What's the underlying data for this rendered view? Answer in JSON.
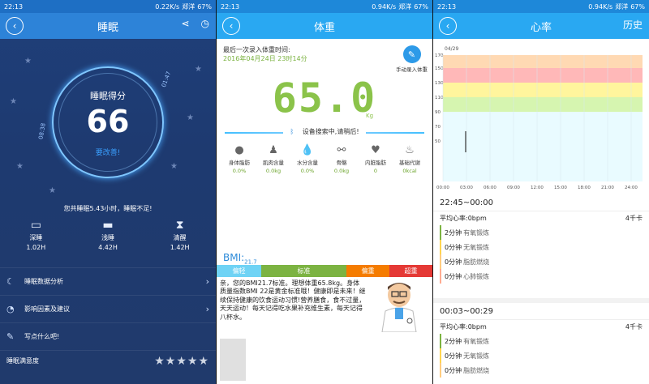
{
  "status": {
    "time": "22:13",
    "s1_speed": "0.22K/s",
    "s23_speed": "0.94K/s",
    "carrier": "郑洋",
    "battery": "67%"
  },
  "sleep": {
    "title": "睡眠",
    "score_label": "睡眠得分",
    "score": "66",
    "score_hint": "要改善!",
    "start_time": "08:38",
    "end_time": "01:47",
    "summary": "您共睡眠5.43小时，睡眠不足!",
    "stages": [
      {
        "label": "深睡",
        "value": "1.02H",
        "icon": "bed-deep-icon"
      },
      {
        "label": "浅睡",
        "value": "4.42H",
        "icon": "bed-light-icon"
      },
      {
        "label": "清醒",
        "value": "1.42H",
        "icon": "clock-icon"
      }
    ],
    "menu": [
      {
        "label": "睡眠数据分析",
        "icon": "moon-icon"
      },
      {
        "label": "影响因素及建议",
        "icon": "gauge-icon"
      },
      {
        "label": "写点什么吧!",
        "icon": "edit-icon"
      }
    ],
    "satisfaction_label": "睡眠满意度",
    "rating_stars": 5,
    "accent": "#3aa0ff"
  },
  "weight": {
    "title": "体重",
    "last_label": "最后一次录入体重时间:",
    "last_date": "2016年04月24日 23时14分",
    "manual_label": "手动录入体重",
    "value": "65.0",
    "unit": "Kg",
    "searching": "设备搜索中,请稍后!",
    "metrics": [
      {
        "label": "身体脂肪",
        "value": "0.0%"
      },
      {
        "label": "肌肉含量",
        "value": "0.0kg"
      },
      {
        "label": "水分含量",
        "value": "0.0%"
      },
      {
        "label": "骨骼",
        "value": "0.0kg"
      },
      {
        "label": "内脏脂肪",
        "value": "0"
      },
      {
        "label": "基础代谢",
        "value": "0kcal"
      }
    ],
    "bmi_label": "BMI:",
    "bmi_value": "21.7",
    "bmi_levels": [
      {
        "label": "偏轻",
        "color": "#6fd3f5"
      },
      {
        "label": "标准",
        "color": "#7cb342"
      },
      {
        "label": "偏重",
        "color": "#f57c00"
      },
      {
        "label": "超重",
        "color": "#e53935"
      }
    ],
    "advice": "亲，您的BMI21.7标准。理想体重65.8kg。身体质量指数BMI 22是黄金标准哦！健康即是未来！继续保持健康的饮食运动习惯!营养膳食，食不过量，天天运动！每天记得吃水果补充维生素，每天记得八杯水。"
  },
  "heart": {
    "title": "心率",
    "history_label": "历史",
    "chart_date": "04/29",
    "y_ticks": [
      "170",
      "150",
      "130",
      "110",
      "90",
      "70",
      "50"
    ],
    "x_ticks": [
      "00:00",
      "03:00",
      "06:00",
      "09:00",
      "12:00",
      "15:00",
      "18:00",
      "21:00",
      "24:00"
    ],
    "sessions": [
      {
        "time": "22:45~00:00",
        "avg": "平均心率:0bpm",
        "kcal": "4千卡",
        "rows": [
          {
            "dur": "2分钟",
            "label": "有氧锻炼",
            "color": "#7cb342"
          },
          {
            "dur": "0分钟",
            "label": "无氧锻炼",
            "color": "#ffd54f"
          },
          {
            "dur": "0分钟",
            "label": "脂肪燃烧",
            "color": "#ffcc80"
          },
          {
            "dur": "0分钟",
            "label": "心肺锻炼",
            "color": "#ffab91"
          }
        ]
      },
      {
        "time": "00:03~00:29",
        "avg": "平均心率:0bpm",
        "kcal": "4千卡",
        "rows": [
          {
            "dur": "2分钟",
            "label": "有氧锻炼",
            "color": "#7cb342"
          },
          {
            "dur": "0分钟",
            "label": "无氧锻炼",
            "color": "#ffd54f"
          },
          {
            "dur": "0分钟",
            "label": "脂肪燃烧",
            "color": "#ffcc80"
          }
        ]
      }
    ]
  }
}
